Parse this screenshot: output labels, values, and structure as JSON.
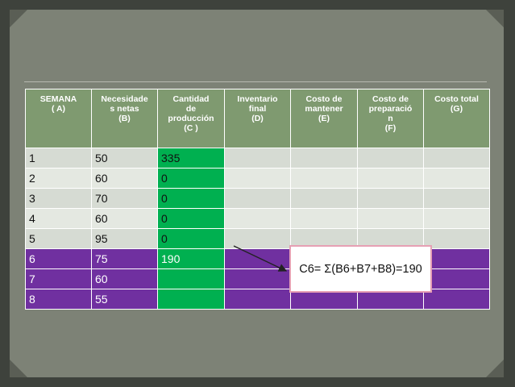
{
  "table": {
    "headers": [
      [
        "SEMANA",
        "( A)"
      ],
      [
        "Necesidade",
        "s netas",
        "(B)"
      ],
      [
        "Cantidad",
        "de",
        "producción",
        "(C )"
      ],
      [
        "Inventario",
        "final",
        "(D)"
      ],
      [
        "Costo de",
        "mantener",
        "(E)"
      ],
      [
        "Costo de",
        "preparació",
        "n",
        "(F)"
      ],
      [
        "Costo total",
        "(G)"
      ]
    ],
    "rows": [
      {
        "a": "1",
        "b": "50",
        "c": "335"
      },
      {
        "a": "2",
        "b": "60",
        "c": "0"
      },
      {
        "a": "3",
        "b": "70",
        "c": "0"
      },
      {
        "a": "4",
        "b": "60",
        "c": "0"
      },
      {
        "a": "5",
        "b": "95",
        "c": "0"
      },
      {
        "a": "6",
        "b": "75",
        "c": "190"
      },
      {
        "a": "7",
        "b": "60",
        "c": ""
      },
      {
        "a": "8",
        "b": "55",
        "c": ""
      }
    ]
  },
  "callout": {
    "text": "C6= Σ(B6+B7+B8)=190"
  },
  "colors": {
    "header": "#7f9a70",
    "highlight_green": "#00b050",
    "highlight_purple": "#7030a0",
    "row_light": "#d6dbd3",
    "callout_border": "#e6a0b4"
  }
}
